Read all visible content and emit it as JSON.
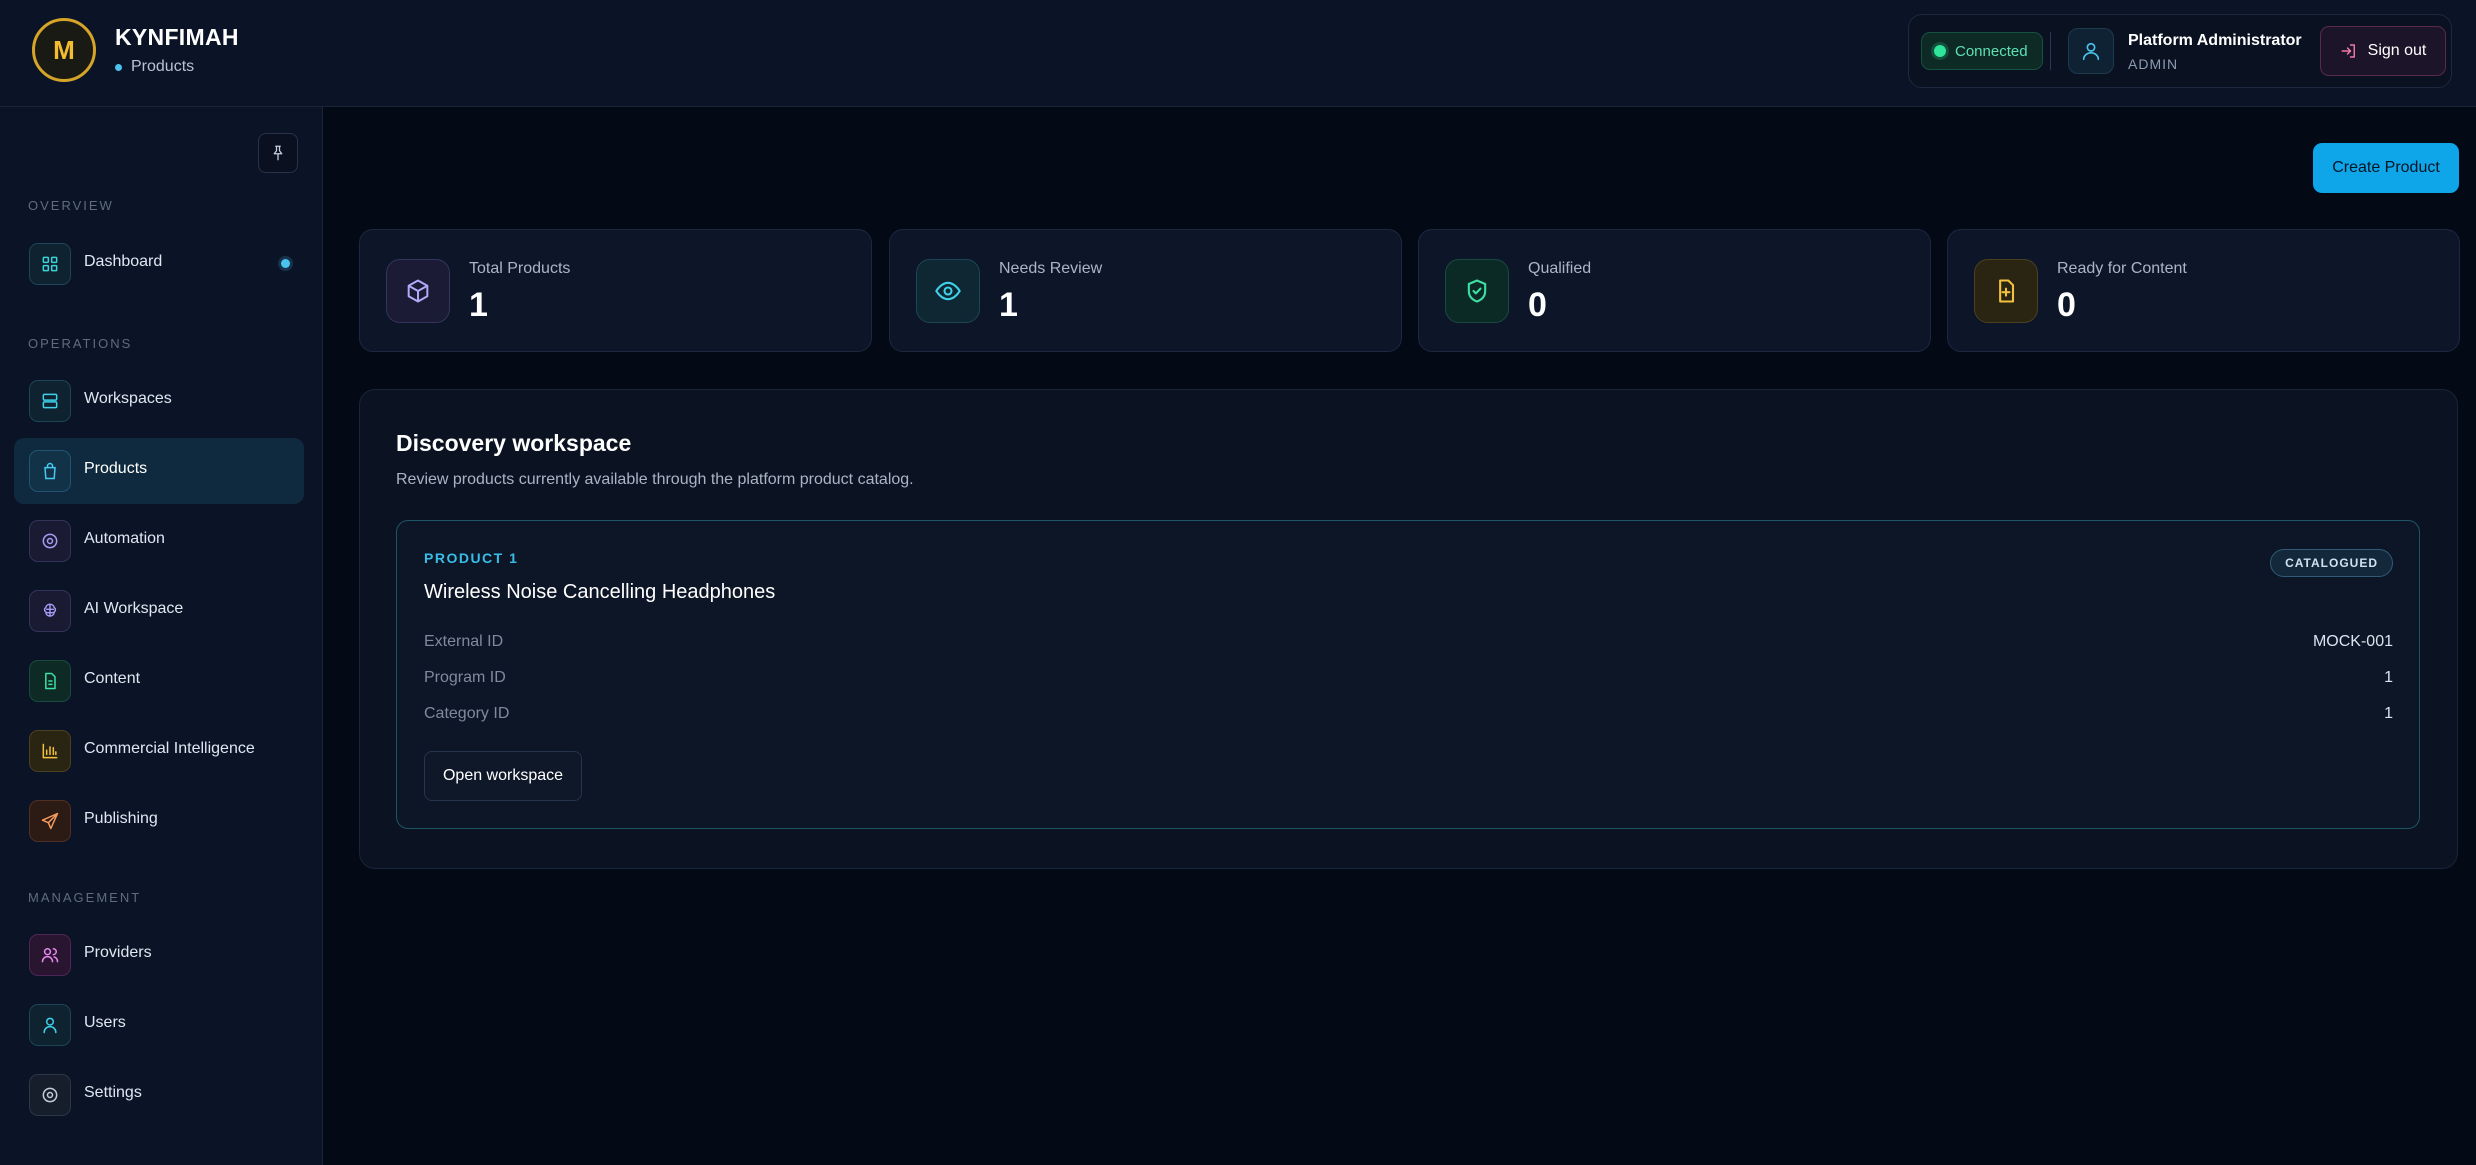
{
  "header": {
    "brand_initial": "M",
    "brand_name": "KYNFIMAH",
    "breadcrumb": "Products",
    "connection_status": "Connected",
    "user_name": "Platform Administrator",
    "user_role": "ADMIN",
    "signout_label": "Sign out"
  },
  "sidebar": {
    "sections": {
      "overview": "OVERVIEW",
      "operations": "OPERATIONS",
      "management": "MANAGEMENT"
    },
    "items": [
      {
        "label": "Dashboard",
        "icon": "grid-icon"
      },
      {
        "label": "Workspaces",
        "icon": "server-icon"
      },
      {
        "label": "Products",
        "icon": "bag-icon",
        "active": true
      },
      {
        "label": "Automation",
        "icon": "target-icon"
      },
      {
        "label": "AI Workspace",
        "icon": "brain-icon"
      },
      {
        "label": "Content",
        "icon": "document-icon"
      },
      {
        "label": "Commercial Intelligence",
        "icon": "bar-chart-icon"
      },
      {
        "label": "Publishing",
        "icon": "send-icon"
      },
      {
        "label": "Providers",
        "icon": "users-icon"
      },
      {
        "label": "Users",
        "icon": "user-icon"
      },
      {
        "label": "Settings",
        "icon": "gear-icon"
      }
    ]
  },
  "main": {
    "create_label": "Create Product",
    "stats": [
      {
        "label": "Total Products",
        "value": "1",
        "icon": "cube-icon"
      },
      {
        "label": "Needs Review",
        "value": "1",
        "icon": "eye-icon"
      },
      {
        "label": "Qualified",
        "value": "0",
        "icon": "shield-check-icon"
      },
      {
        "label": "Ready for Content",
        "value": "0",
        "icon": "file-plus-icon"
      }
    ],
    "workspace": {
      "title": "Discovery workspace",
      "description": "Review products currently available through the platform product catalog.",
      "product": {
        "kicker": "PRODUCT 1",
        "name": "Wireless Noise Cancelling Headphones",
        "status": "CATALOGUED",
        "fields": [
          {
            "key": "External ID",
            "value": "MOCK-001"
          },
          {
            "key": "Program ID",
            "value": "1"
          },
          {
            "key": "Category ID",
            "value": "1"
          }
        ],
        "open_label": "Open workspace"
      }
    }
  },
  "colors": {
    "accent": "#0ea5e9",
    "background": "#040916",
    "panel": "#0b1426",
    "logo_gold": "#d6a429",
    "connected_green": "#2ee59a"
  }
}
